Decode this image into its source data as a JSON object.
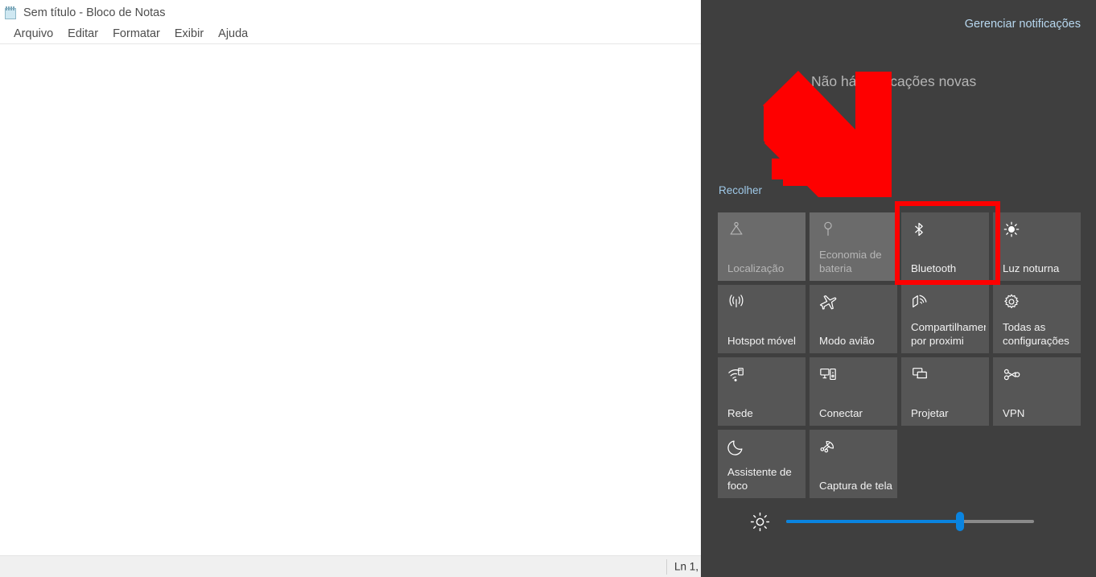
{
  "notepad": {
    "title": "Sem título - Bloco de Notas",
    "icon": "notepad-icon",
    "menu": [
      "Arquivo",
      "Editar",
      "Formatar",
      "Exibir",
      "Ajuda"
    ],
    "text_value": "",
    "text_placeholder": "",
    "status": "Ln 1,"
  },
  "action_center": {
    "manage_link": "Gerenciar notificações",
    "empty_message": "Não há notificações novas",
    "collapse_link": "Recolher",
    "tiles": [
      {
        "label": "Localização",
        "icon": "location-icon",
        "state": "disabled"
      },
      {
        "label": "Economia de bateria",
        "icon": "battery-saver-icon",
        "state": "disabled"
      },
      {
        "label": "Bluetooth",
        "icon": "bluetooth-icon",
        "state": "normal",
        "highlighted": true
      },
      {
        "label": "Luz noturna",
        "icon": "night-light-icon",
        "state": "normal"
      },
      {
        "label": "Hotspot móvel",
        "icon": "hotspot-icon",
        "state": "normal"
      },
      {
        "label": "Modo avião",
        "icon": "airplane-icon",
        "state": "normal"
      },
      {
        "label": "Compartilhamento por proximi",
        "icon": "nearby-share-icon",
        "state": "normal"
      },
      {
        "label": "Todas as configurações",
        "icon": "gear-icon",
        "state": "normal"
      },
      {
        "label": "Rede",
        "icon": "network-icon",
        "state": "normal"
      },
      {
        "label": "Conectar",
        "icon": "connect-icon",
        "state": "normal"
      },
      {
        "label": "Projetar",
        "icon": "project-icon",
        "state": "normal"
      },
      {
        "label": "VPN",
        "icon": "vpn-icon",
        "state": "normal"
      },
      {
        "label": "Assistente de foco",
        "icon": "moon-icon",
        "state": "normal"
      },
      {
        "label": "Captura de tela",
        "icon": "snip-icon",
        "state": "normal"
      }
    ],
    "brightness": {
      "icon": "brightness-icon",
      "value_percent": 70
    }
  },
  "annotations": {
    "arrow": {
      "shape": "arrow-down-right",
      "color": "#fe0000"
    },
    "highlight": {
      "target": "Bluetooth",
      "color": "#fe0000"
    }
  },
  "colors": {
    "panel_bg": "#3f3f3f",
    "tile_bg": "#565656",
    "tile_disabled_bg": "#6b6b6b",
    "accent": "#0a84e0",
    "annotation_red": "#fe0000",
    "link_blue": "#9fc9e8"
  }
}
